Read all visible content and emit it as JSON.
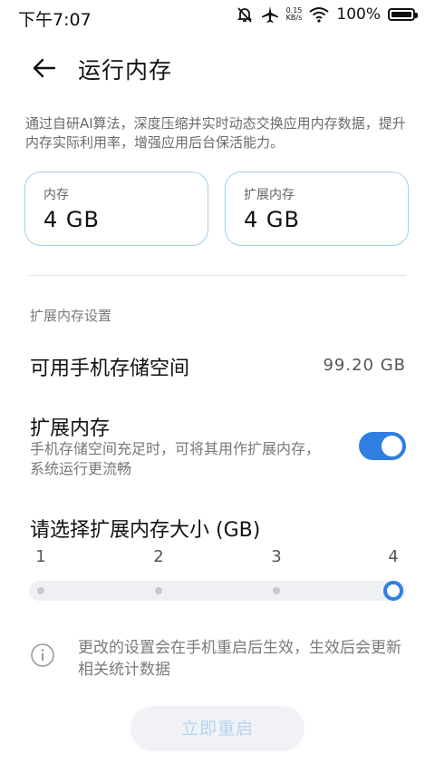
{
  "status_bar": {
    "time": "下午7:07",
    "net_speed_value": "0.15",
    "net_speed_unit": "KB/s",
    "battery": "100%",
    "battery_level": 1.0,
    "icons": [
      "mute-bell-icon",
      "airplane-icon",
      "wifi-icon",
      "battery-icon"
    ]
  },
  "header": {
    "title": "运行内存",
    "back_icon": "back-arrow-icon"
  },
  "description": "通过自研AI算法，深度压缩并实时动态交换应用内存数据，提升内存实际利用率，增强应用后台保活能力。",
  "cards": [
    {
      "label": "内存",
      "value": "4 GB"
    },
    {
      "label": "扩展内存",
      "value": "4 GB"
    }
  ],
  "section_header": "扩展内存设置",
  "storage": {
    "label": "可用手机存储空间",
    "value": "99.20 GB"
  },
  "expand_memory": {
    "label": "扩展内存",
    "description": "手机存储空间充足时，可将其用作扩展内存，系统运行更流畅",
    "enabled": true
  },
  "size_selector": {
    "label": "请选择扩展内存大小 (GB)",
    "ticks": [
      "1",
      "2",
      "3",
      "4"
    ],
    "selected": "4"
  },
  "notice": {
    "icon": "info-icon",
    "text": "更改的设置会在手机重启后生效，生效后会更新相关统计数据"
  },
  "restart_button": "立即重启",
  "colors": {
    "accent": "#2f7fe3",
    "card_border": "#9fd3ec",
    "disabled_button_text": "#b6d4f2"
  }
}
